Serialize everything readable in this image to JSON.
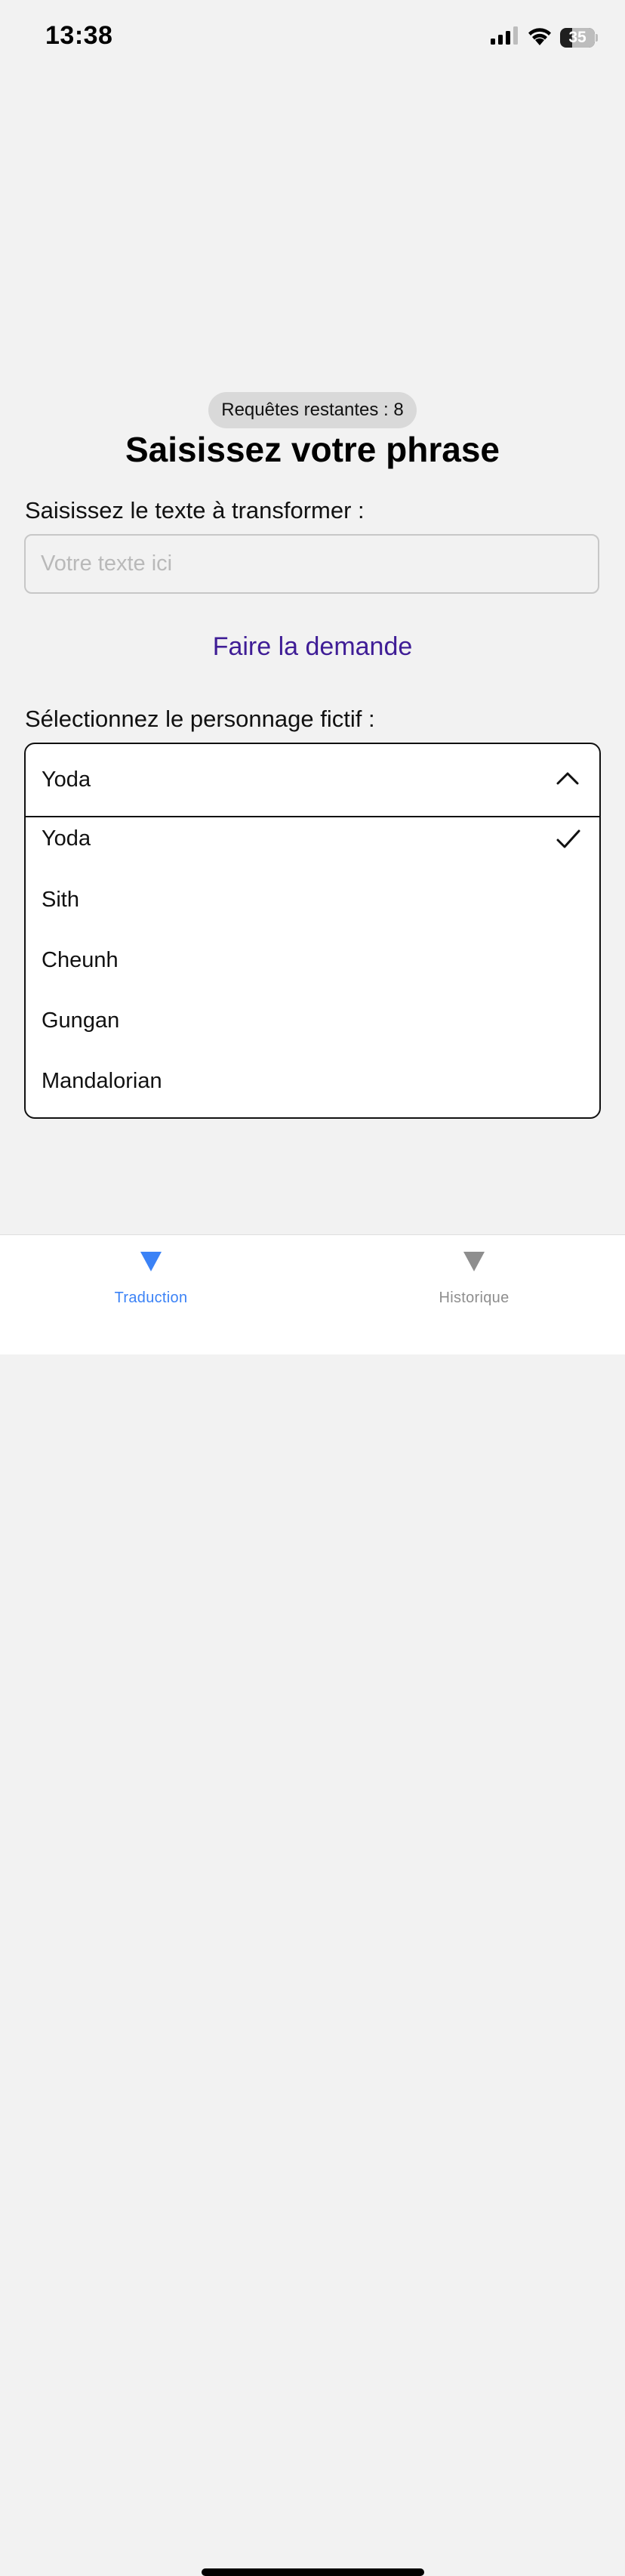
{
  "status_bar": {
    "time": "13:38",
    "battery_level": "35",
    "battery_fraction": 0.35,
    "signal_bars_active": 3,
    "signal_bars_total": 4
  },
  "quota": {
    "text": "Requêtes restantes : 8"
  },
  "page": {
    "title": "Saisissez votre phrase"
  },
  "input": {
    "label": "Saisissez le texte à transformer :",
    "value": "",
    "placeholder": "Votre texte ici"
  },
  "submit": {
    "label": "Faire la demande"
  },
  "character_select": {
    "label": "Sélectionnez le personnage fictif :",
    "selected": "Yoda",
    "expanded": true,
    "options": [
      {
        "label": "Yoda",
        "checked": true
      },
      {
        "label": "Sith",
        "checked": false
      },
      {
        "label": "Cheunh",
        "checked": false
      },
      {
        "label": "Gungan",
        "checked": false
      },
      {
        "label": "Mandalorian",
        "checked": false
      }
    ]
  },
  "tab_bar": {
    "tabs": [
      {
        "label": "Traduction",
        "active": true,
        "icon": "triangle-down-icon",
        "color": "#3b82f6"
      },
      {
        "label": "Historique",
        "active": false,
        "icon": "triangle-down-icon",
        "color": "#8e8e8e"
      }
    ]
  },
  "colors": {
    "background": "#f2f2f2",
    "accent": "#3f1d96",
    "tab_active": "#3b82f6",
    "tab_inactive": "#8e8e8e"
  }
}
